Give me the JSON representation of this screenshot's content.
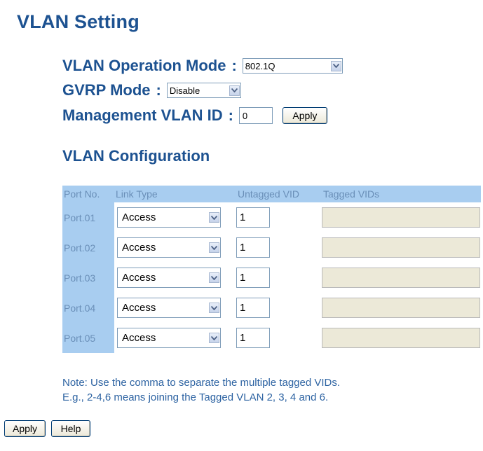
{
  "page": {
    "title": "VLAN Setting"
  },
  "settings": {
    "operation_mode": {
      "label": "VLAN Operation Mode",
      "colon": ":",
      "value": "802.1Q"
    },
    "gvrp_mode": {
      "label": "GVRP Mode",
      "colon": ":",
      "value": "Disable"
    },
    "management_vlan": {
      "label": "Management VLAN ID",
      "colon": ":",
      "value": "0",
      "apply_label": "Apply"
    }
  },
  "vlan_config": {
    "title": "VLAN Configuration",
    "headers": [
      "Port No.",
      "Link Type",
      "Untagged VID",
      "Tagged VIDs"
    ],
    "rows": [
      {
        "port": "Port.01",
        "link_type": "Access",
        "untagged_vid": "1",
        "tagged_vids": ""
      },
      {
        "port": "Port.02",
        "link_type": "Access",
        "untagged_vid": "1",
        "tagged_vids": ""
      },
      {
        "port": "Port.03",
        "link_type": "Access",
        "untagged_vid": "1",
        "tagged_vids": ""
      },
      {
        "port": "Port.04",
        "link_type": "Access",
        "untagged_vid": "1",
        "tagged_vids": ""
      },
      {
        "port": "Port.05",
        "link_type": "Access",
        "untagged_vid": "1",
        "tagged_vids": ""
      }
    ]
  },
  "note": {
    "line1": "Note: Use the comma to separate the multiple tagged VIDs.",
    "line2": "E.g., 2-4,6 means joining the Tagged VLAN 2, 3, 4 and 6."
  },
  "footer": {
    "apply_label": "Apply",
    "help_label": "Help"
  },
  "colors": {
    "heading": "#1d5291",
    "table_header_bg": "#a8cdf0",
    "table_header_text": "#6a8fb8",
    "disabled_input_bg": "#ece9d8"
  }
}
